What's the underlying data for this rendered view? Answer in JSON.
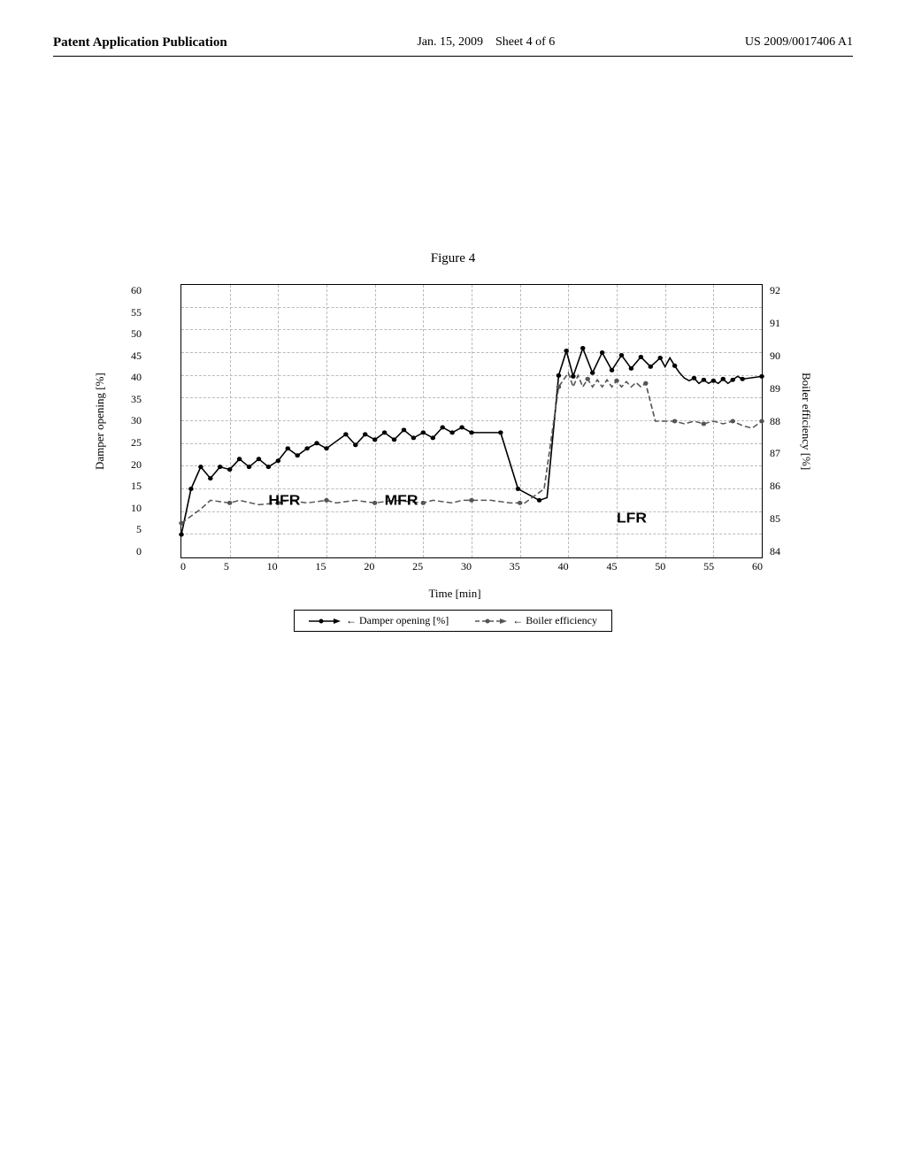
{
  "header": {
    "left": "Patent Application Publication",
    "center_date": "Jan. 15, 2009",
    "center_sheet": "Sheet 4 of 6",
    "right": "US 2009/0017406 A1"
  },
  "figure": {
    "title": "Figure 4"
  },
  "chart": {
    "left_axis_label": "Damper opening [%]",
    "right_axis_label": "Boiler efficiency  [%]",
    "x_axis_label": "Time   [min]",
    "left_y_ticks": [
      "0",
      "5",
      "10",
      "15",
      "20",
      "25",
      "30",
      "35",
      "40",
      "45",
      "50",
      "55",
      "60"
    ],
    "right_y_ticks": [
      "84",
      "85",
      "86",
      "87",
      "88",
      "89",
      "90",
      "91",
      "92"
    ],
    "x_ticks": [
      "0",
      "5",
      "10",
      "15",
      "20",
      "25",
      "30",
      "35",
      "40",
      "45",
      "50",
      "55",
      "60"
    ],
    "regions": {
      "hfr": "HFR",
      "mfr": "MFR",
      "lfr": "LFR"
    }
  },
  "legend": {
    "item1": "← Damper opening [%]",
    "item2": "← Boiler efficiency"
  }
}
